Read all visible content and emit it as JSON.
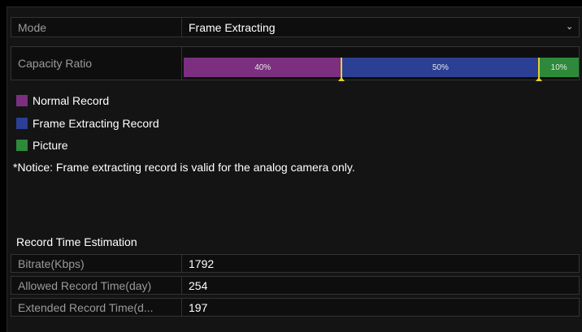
{
  "mode": {
    "label": "Mode",
    "value": "Frame Extracting"
  },
  "capacity": {
    "label": "Capacity Ratio",
    "segments": [
      {
        "name": "normal",
        "value": 40,
        "text": "40%",
        "color": "#7b2f7e"
      },
      {
        "name": "frame",
        "value": 50,
        "text": "50%",
        "color": "#2b3f94"
      },
      {
        "name": "picture",
        "value": 10,
        "text": "10%",
        "color": "#2d8a3a"
      }
    ]
  },
  "legend": [
    {
      "label": "Normal Record",
      "color": "#7b2f7e"
    },
    {
      "label": "Frame Extracting Record",
      "color": "#2b3f94"
    },
    {
      "label": "Picture",
      "color": "#2d8a3a"
    }
  ],
  "notice": "*Notice: Frame extracting record is valid for the analog camera only.",
  "estimation": {
    "title": "Record Time Estimation",
    "rows": [
      {
        "label": "Bitrate(Kbps)",
        "value": "1792"
      },
      {
        "label": "Allowed Record Time(day)",
        "value": "254"
      },
      {
        "label": "Extended Record Time(d...",
        "value": "197"
      }
    ]
  }
}
